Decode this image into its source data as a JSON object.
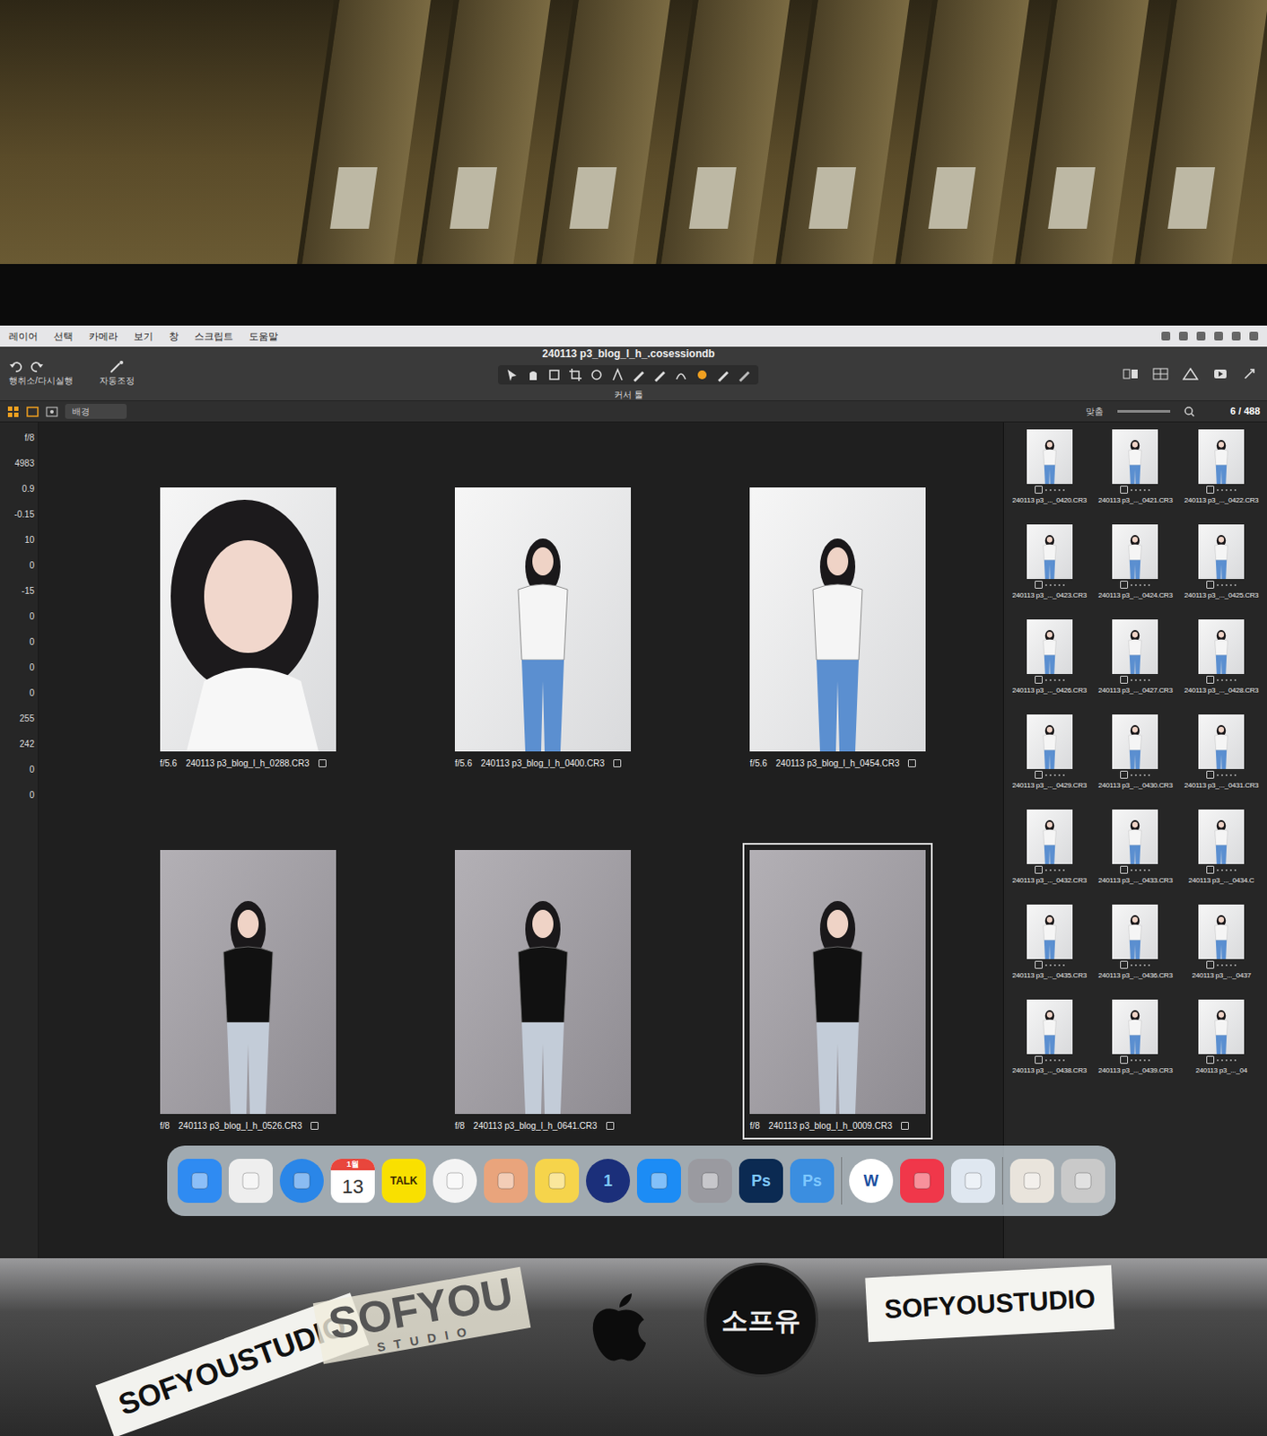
{
  "menu": {
    "items": [
      "레이어",
      "선택",
      "카메라",
      "보기",
      "창",
      "스크립트",
      "도움말"
    ]
  },
  "window": {
    "title": "240113 p3_blog_l_h_.cosessiondb"
  },
  "toolbar": {
    "undo_label": "행취소/다시실행",
    "auto_label": "자동조정",
    "cursor_label": "커서 툴",
    "count": "6 / 488"
  },
  "subbar": {
    "layer": "배경",
    "zoom": "맞춤"
  },
  "left_panel": {
    "values": [
      "f/8",
      "4983",
      "0.9",
      "-0.15",
      "10",
      "0",
      "-15",
      "0",
      "0",
      "0",
      "0",
      "255",
      "242",
      "0",
      "0"
    ]
  },
  "viewer": {
    "photos": [
      {
        "aperture": "f/5.6",
        "file": "240113 p3_blog_l_h_0288.CR3",
        "kind": "closeup",
        "selected": false
      },
      {
        "aperture": "f/5.6",
        "file": "240113 p3_blog_l_h_0400.CR3",
        "kind": "white",
        "selected": false
      },
      {
        "aperture": "f/5.6",
        "file": "240113 p3_blog_l_h_0454.CR3",
        "kind": "white",
        "selected": false
      },
      {
        "aperture": "f/8",
        "file": "240113 p3_blog_l_h_0526.CR3",
        "kind": "grey",
        "selected": false
      },
      {
        "aperture": "f/8",
        "file": "240113 p3_blog_l_h_0641.CR3",
        "kind": "grey",
        "selected": false
      },
      {
        "aperture": "f/8",
        "file": "240113 p3_blog_l_h_0009.CR3",
        "kind": "grey",
        "selected": true
      }
    ]
  },
  "browser": {
    "thumbs": [
      "240113 p3_..._0420.CR3",
      "240113 p3_..._0421.CR3",
      "240113 p3_..._0422.CR3",
      "240113 p3_..._0423.CR3",
      "240113 p3_..._0424.CR3",
      "240113 p3_..._0425.CR3",
      "240113 p3_..._0426.CR3",
      "240113 p3_..._0427.CR3",
      "240113 p3_..._0428.CR3",
      "240113 p3_..._0429.CR3",
      "240113 p3_..._0430.CR3",
      "240113 p3_..._0431.CR3",
      "240113 p3_..._0432.CR3",
      "240113 p3_..._0433.CR3",
      "240113 p3_..._0434.C",
      "240113 p3_..._0435.CR3",
      "240113 p3_..._0436.CR3",
      "240113 p3_..._0437",
      "240113 p3_..._0438.CR3",
      "240113 p3_..._0439.CR3",
      "240113 p3_..._04"
    ]
  },
  "dock": {
    "items": [
      {
        "kind": "tile",
        "color": "#2f8bf2"
      },
      {
        "kind": "tile",
        "color": "#eeeeee"
      },
      {
        "kind": "circle",
        "color": "#2a86e8"
      },
      {
        "kind": "tile",
        "color": "#ffffff",
        "label": "13",
        "badge": "1월"
      },
      {
        "kind": "tile",
        "color": "#f9e000",
        "label": "TALK"
      },
      {
        "kind": "circle",
        "color": "#f4f4f4"
      },
      {
        "kind": "tile",
        "color": "#e9a47c"
      },
      {
        "kind": "tile",
        "color": "#f6d44b"
      },
      {
        "kind": "circle",
        "color": "#1b2f7a",
        "label": "1"
      },
      {
        "kind": "tile",
        "color": "#1c8cf5"
      },
      {
        "kind": "tile",
        "color": "#9a9aa0"
      },
      {
        "kind": "tile",
        "color": "#0b2a52",
        "label": "Ps"
      },
      {
        "kind": "tile",
        "color": "#3b8ee0",
        "label": "Ps"
      },
      {
        "kind": "separator"
      },
      {
        "kind": "circle",
        "color": "#ffffff",
        "label": "W"
      },
      {
        "kind": "tile",
        "color": "#f0374a"
      },
      {
        "kind": "tile",
        "color": "#dfe7f0"
      },
      {
        "kind": "separator"
      },
      {
        "kind": "tile",
        "color": "#e9e4dc"
      },
      {
        "kind": "tile",
        "color": "#c9c9c9"
      }
    ]
  },
  "stickers": [
    {
      "kind": "tilted",
      "text": "SOFYOUSTUDIO"
    },
    {
      "kind": "ghost",
      "text": "SOFYOU",
      "sub": "STUDIO"
    },
    {
      "kind": "circle",
      "text": "소프유"
    },
    {
      "kind": "plate",
      "text": "SOFYOUSTUDIO"
    }
  ]
}
